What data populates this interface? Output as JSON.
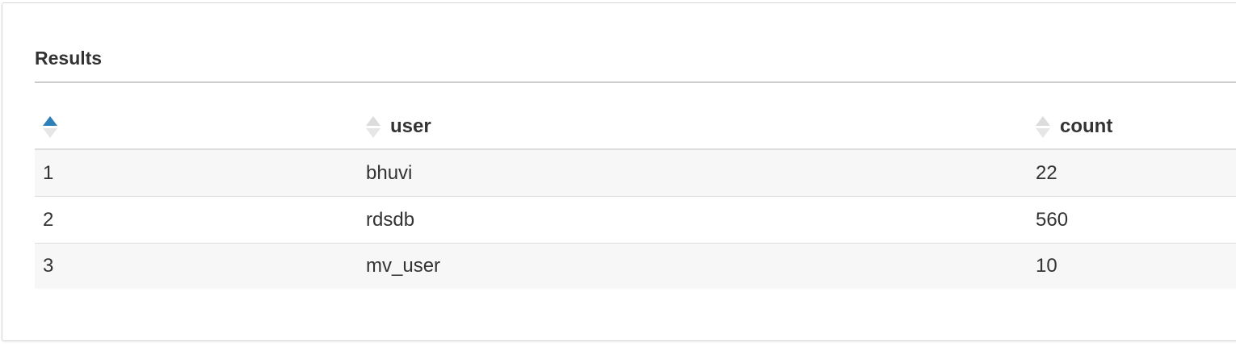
{
  "results": {
    "title": "Results",
    "columns": [
      {
        "label": "",
        "sort": "ascending"
      },
      {
        "label": "user",
        "sort": "none"
      },
      {
        "label": "count",
        "sort": "none"
      }
    ],
    "rows": [
      {
        "index": "1",
        "user": "bhuvi",
        "count": "22"
      },
      {
        "index": "2",
        "user": "rdsdb",
        "count": "560"
      },
      {
        "index": "3",
        "user": "mv_user",
        "count": "10"
      }
    ]
  },
  "colors": {
    "sort_active": "#2d7fb8",
    "sort_inactive": "#dcdcdc",
    "row_stripe": "#f7f7f7",
    "text": "#333333"
  }
}
